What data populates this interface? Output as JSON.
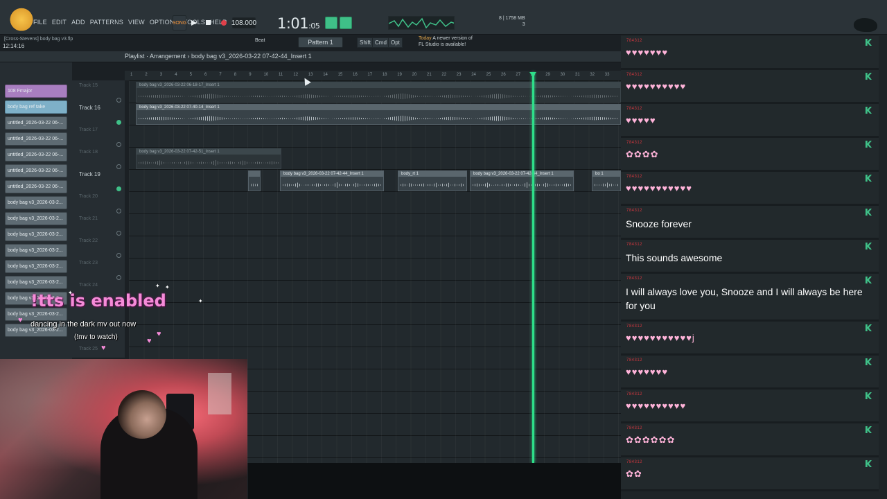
{
  "app": {
    "menu": [
      "FILE",
      "EDIT",
      "ADD",
      "PATTERNS",
      "VIEW",
      "OPTIONS",
      "TOOLS",
      "HELP"
    ],
    "project_title": "[Cross-Stevens] body bag v3.flp",
    "project_time": "12:14:16",
    "song_mode": "SONG",
    "tempo": "108.000",
    "clock_main": "1:01",
    "clock_sub": ":05",
    "cpu_line1": "8 | 1758 MB",
    "cpu_line2": "3",
    "beat_label": "Beat",
    "pattern_label": "Pattern 1",
    "shift_label": "Shift",
    "cmd_label": "Cmd",
    "opt_label": "Opt",
    "notice_line1_prefix": "Today",
    "notice_line1": "A newer version of",
    "notice_line2": "FL Studio is available!",
    "breadcrumb": "Playlist · Arrangement › body bag v3_2026-03-22 07-42-44_Insert 1"
  },
  "browser": {
    "items": [
      "108 Fmajor",
      "body bag ref take",
      "untitled_2026-03-22 06-...",
      "untitled_2026-03-22 06-...",
      "untitled_2026-03-22 06-...",
      "untitled_2026-03-22 06-...",
      "untitled_2026-03-22 06-...",
      "body bag v3_2026-03-2...",
      "body bag v3_2026-03-2...",
      "body bag v3_2026-03-2...",
      "body bag v3_2026-03-2...",
      "body bag v3_2026-03-2...",
      "body bag v3_2026-03-2...",
      "body bag v3_2026-03-2...",
      "body bag v3_2026-03-2...",
      "body bag v3_2026-03-2..."
    ]
  },
  "tracks": {
    "t15": "Track 15",
    "t16": "Track 16",
    "t17": "Track 17",
    "t18": "Track 18",
    "t19": "Track 19",
    "t20": "Track 20",
    "t21": "Track 21",
    "t22": "Track 22",
    "t23": "Track 23",
    "t24": "Track 24",
    "t25": "Track 25"
  },
  "clips": {
    "c15": "body bag v3_2026-03-22 06-18-17_Insert 1",
    "c16": "body bag v3_2026-03-22 07-40-14_Insert 1",
    "c18": "body bag v3_2026-03-22 07-42-51_Insert 1",
    "c19a": "body bag v3_2026-03-22 07-42-44_Insert 1",
    "c19b": "body_rt 1",
    "c19c": "body bag v3_2026-03-22 07-42-44_Insert 1",
    "c19d": "bo 1"
  },
  "ruler": [
    "1",
    "2",
    "3",
    "4",
    "5",
    "6",
    "7",
    "8",
    "9",
    "10",
    "11",
    "12",
    "13",
    "14",
    "15",
    "16",
    "17",
    "18",
    "19",
    "20",
    "21",
    "22",
    "23",
    "24",
    "25",
    "26",
    "27",
    "28",
    "29",
    "30",
    "31",
    "32",
    "33"
  ],
  "overlay": {
    "tts": "!tts is enabled",
    "mv": "dancing in the dark mv out now",
    "watch": "(!mv to watch)"
  },
  "chat": {
    "username": "784312",
    "messages": [
      {
        "type": "emote",
        "text": "♥♥♥♥♥♥♥"
      },
      {
        "type": "emote",
        "text": "♥♥♥♥♥♥♥♥♥♥"
      },
      {
        "type": "emote",
        "text": "♥♥♥♥♥"
      },
      {
        "type": "emote",
        "text": "✿✿✿✿"
      },
      {
        "type": "emote",
        "text": "♥♥♥♥♥♥♥♥♥♥♥"
      },
      {
        "type": "text",
        "text": "Snooze forever"
      },
      {
        "type": "text",
        "text": "This sounds awesome"
      },
      {
        "type": "text",
        "text": "I will always love you, Snooze and I will always be here for you"
      },
      {
        "type": "emote",
        "text": "♥♥♥♥♥♥♥♥♥♥♥j"
      },
      {
        "type": "emote",
        "text": "♥♥♥♥♥♥♥"
      },
      {
        "type": "emote",
        "text": "♥♥♥♥♥♥♥♥♥♥"
      },
      {
        "type": "emote",
        "text": "✿✿✿✿✿✿"
      },
      {
        "type": "emote",
        "text": "✿✿"
      }
    ]
  },
  "colors": {
    "accent_green": "#3fc088",
    "playhead": "#2ee08a",
    "chat_user": "#d0373f",
    "tts_pink": "#f58bd8"
  },
  "icons": [
    "mascot-icon",
    "play-icon",
    "stop-icon",
    "record-icon",
    "k-badge-icon",
    "mouse-cursor-icon"
  ]
}
